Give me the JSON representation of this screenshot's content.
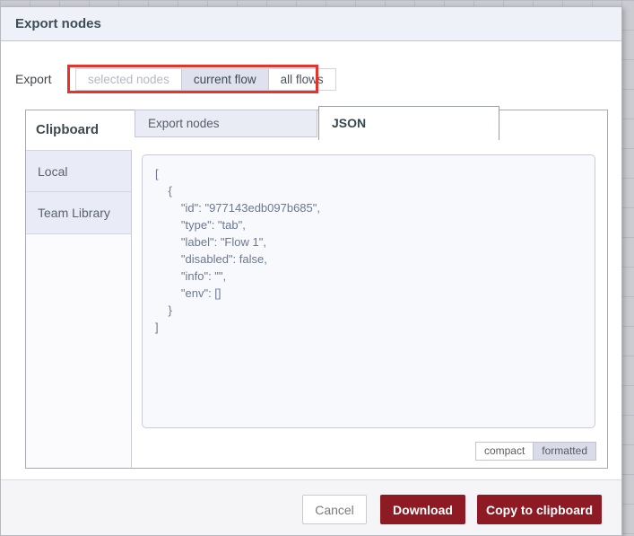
{
  "dialog": {
    "title": "Export nodes",
    "export_row": {
      "label": "Export",
      "options": [
        {
          "label": "selected nodes",
          "state": "disabled"
        },
        {
          "label": "current flow",
          "state": "selected"
        },
        {
          "label": "all flows",
          "state": "normal"
        }
      ]
    },
    "tabs": {
      "section_label": "Clipboard",
      "items": [
        {
          "label": "Export nodes",
          "active": false
        },
        {
          "label": "JSON",
          "active": true
        }
      ]
    },
    "sidebar": {
      "items": [
        {
          "label": "Local"
        },
        {
          "label": "Team Library"
        }
      ]
    },
    "json_view": {
      "content": "[\n    {\n        \"id\": \"977143edb097b685\",\n        \"type\": \"tab\",\n        \"label\": \"Flow 1\",\n        \"disabled\": false,\n        \"info\": \"\",\n        \"env\": []\n    }\n]",
      "format_toggle": [
        {
          "label": "compact",
          "selected": false
        },
        {
          "label": "formatted",
          "selected": true
        }
      ]
    },
    "footer": {
      "cancel_label": "Cancel",
      "download_label": "Download",
      "copy_label": "Copy to clipboard"
    },
    "colors": {
      "primary_button": "#8e1a23",
      "annotation_red": "#e7342a",
      "header_bg": "#eff1f9",
      "tab_inactive_bg": "#e9ebf5",
      "selected_option_bg": "#dfe1ef"
    }
  }
}
